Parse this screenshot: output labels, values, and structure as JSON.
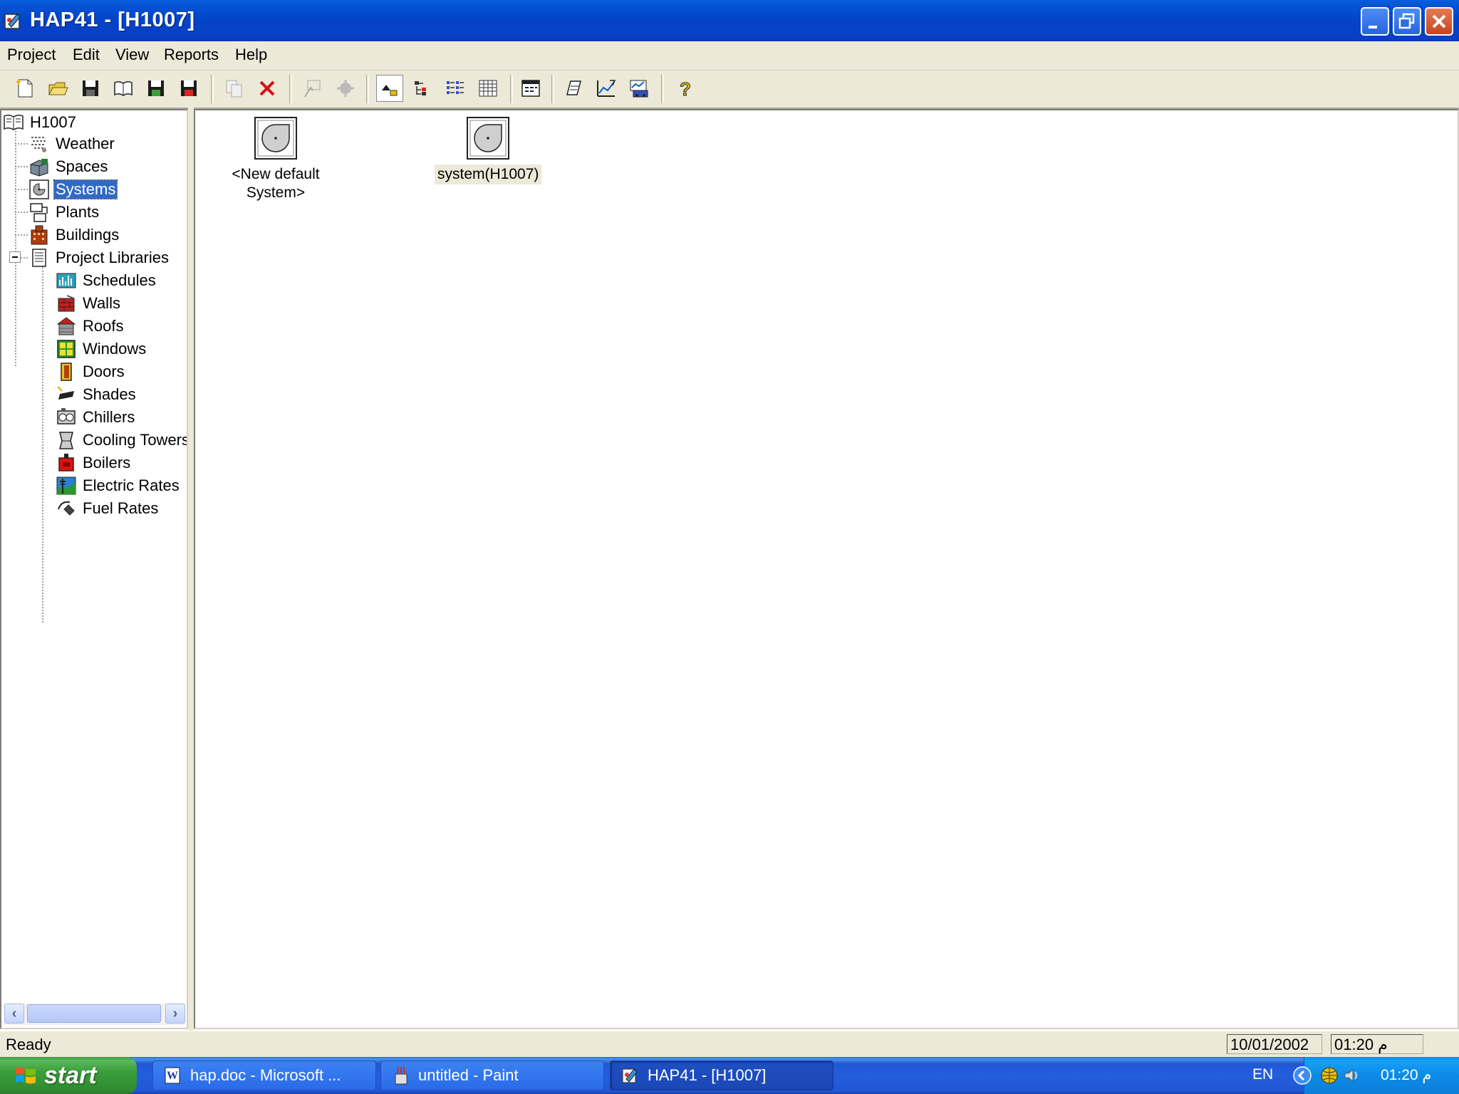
{
  "window": {
    "title": "HAP41 - [H1007]"
  },
  "menu": [
    "Project",
    "Edit",
    "View",
    "Reports",
    "Help"
  ],
  "toolbar": {
    "buttons": [
      "new-icon",
      "open-icon",
      "save-icon",
      "library-icon",
      "save-as-icon",
      "archive-icon",
      "copy-icon",
      "delete-icon",
      "properties-icon",
      "duplicate-icon",
      "large-icons-icon",
      "small-icons-icon",
      "list-icon",
      "details-icon",
      "calendar-icon",
      "print-icon",
      "report-icon",
      "multiple-report-icon",
      "help-icon"
    ]
  },
  "tree": {
    "root": "H1007",
    "items": [
      {
        "label": "Weather",
        "icon": "weather-icon"
      },
      {
        "label": "Spaces",
        "icon": "spaces-icon"
      },
      {
        "label": "Systems",
        "icon": "systems-icon",
        "selected": true
      },
      {
        "label": "Plants",
        "icon": "plants-icon"
      },
      {
        "label": "Buildings",
        "icon": "buildings-icon"
      },
      {
        "label": "Project Libraries",
        "icon": "libraries-icon"
      }
    ],
    "libraries": [
      {
        "label": "Schedules",
        "icon": "schedules-icon"
      },
      {
        "label": "Walls",
        "icon": "walls-icon"
      },
      {
        "label": "Roofs",
        "icon": "roofs-icon"
      },
      {
        "label": "Windows",
        "icon": "windows-icon"
      },
      {
        "label": "Doors",
        "icon": "doors-icon"
      },
      {
        "label": "Shades",
        "icon": "shades-icon"
      },
      {
        "label": "Chillers",
        "icon": "chillers-icon"
      },
      {
        "label": "Cooling Towers",
        "icon": "cooling-towers-icon"
      },
      {
        "label": "Boilers",
        "icon": "boilers-icon"
      },
      {
        "label": "Electric Rates",
        "icon": "electric-rates-icon"
      },
      {
        "label": "Fuel Rates",
        "icon": "fuel-rates-icon"
      }
    ]
  },
  "content": {
    "items": [
      {
        "line1": "<New default",
        "line2": "System>"
      },
      {
        "line1": "system(H1007)",
        "line2": ""
      }
    ]
  },
  "status": {
    "text": "Ready",
    "date": "10/01/2002",
    "time": "01:20 م"
  },
  "taskbar": {
    "start": "start",
    "tasks": [
      "hap.doc - Microsoft ...",
      "untitled - Paint",
      "HAP41 - [H1007]"
    ],
    "lang": "EN",
    "clock": "01:20 م"
  }
}
